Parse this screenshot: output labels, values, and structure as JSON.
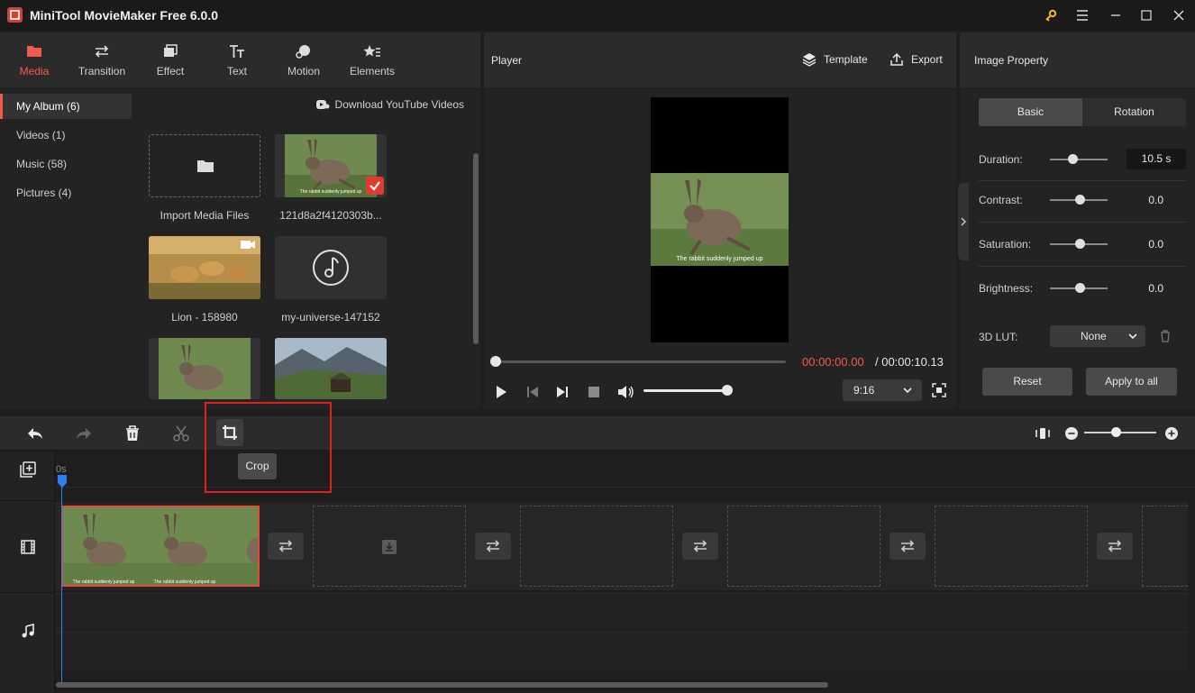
{
  "app": {
    "title": "MiniTool MovieMaker Free 6.0.0"
  },
  "media_tabs": [
    {
      "label": "Media",
      "icon": "folder-icon",
      "active": true
    },
    {
      "label": "Transition",
      "icon": "transition-arrows-icon",
      "active": false
    },
    {
      "label": "Effect",
      "icon": "effect-icon",
      "active": false
    },
    {
      "label": "Text",
      "icon": "text-icon",
      "active": false
    },
    {
      "label": "Motion",
      "icon": "motion-icon",
      "active": false
    },
    {
      "label": "Elements",
      "icon": "elements-icon",
      "active": false
    }
  ],
  "albums": [
    {
      "label": "My Album (6)",
      "active": true
    },
    {
      "label": "Videos (1)"
    },
    {
      "label": "Music (58)"
    },
    {
      "label": "Pictures (4)"
    }
  ],
  "media": {
    "download_label": "Download YouTube Videos",
    "items": [
      {
        "label": "Import Media Files"
      },
      {
        "label": "121d8a2f4120303b..."
      },
      {
        "label": "Lion - 158980"
      },
      {
        "label": "my-universe-147152"
      }
    ],
    "thumb_caption": "The rabbit suddenly jumped up"
  },
  "player": {
    "title": "Player",
    "template_label": "Template",
    "export_label": "Export",
    "current_time": "00:00:00.00",
    "total_time": "/ 00:00:10.13",
    "aspect_ratio": "9:16",
    "progress": 0,
    "volume": 1.0
  },
  "property": {
    "title": "Image Property",
    "tabs": [
      "Basic",
      "Rotation"
    ],
    "duration_label": "Duration:",
    "duration_value": "10.5 s",
    "contrast_label": "Contrast:",
    "contrast_value": "0.0",
    "saturation_label": "Saturation:",
    "saturation_value": "0.0",
    "brightness_label": "Brightness:",
    "brightness_value": "0.0",
    "lut_label": "3D LUT:",
    "lut_value": "None",
    "reset_label": "Reset",
    "apply_label": "Apply to all"
  },
  "timeline": {
    "crop_tooltip": "Crop",
    "ruler_start": "0s",
    "clip_caption": "The rabbit suddenly jumped up"
  },
  "colors": {
    "accent": "#f25a4b",
    "highlight": "#e0211b",
    "playhead": "#2f80ed"
  }
}
